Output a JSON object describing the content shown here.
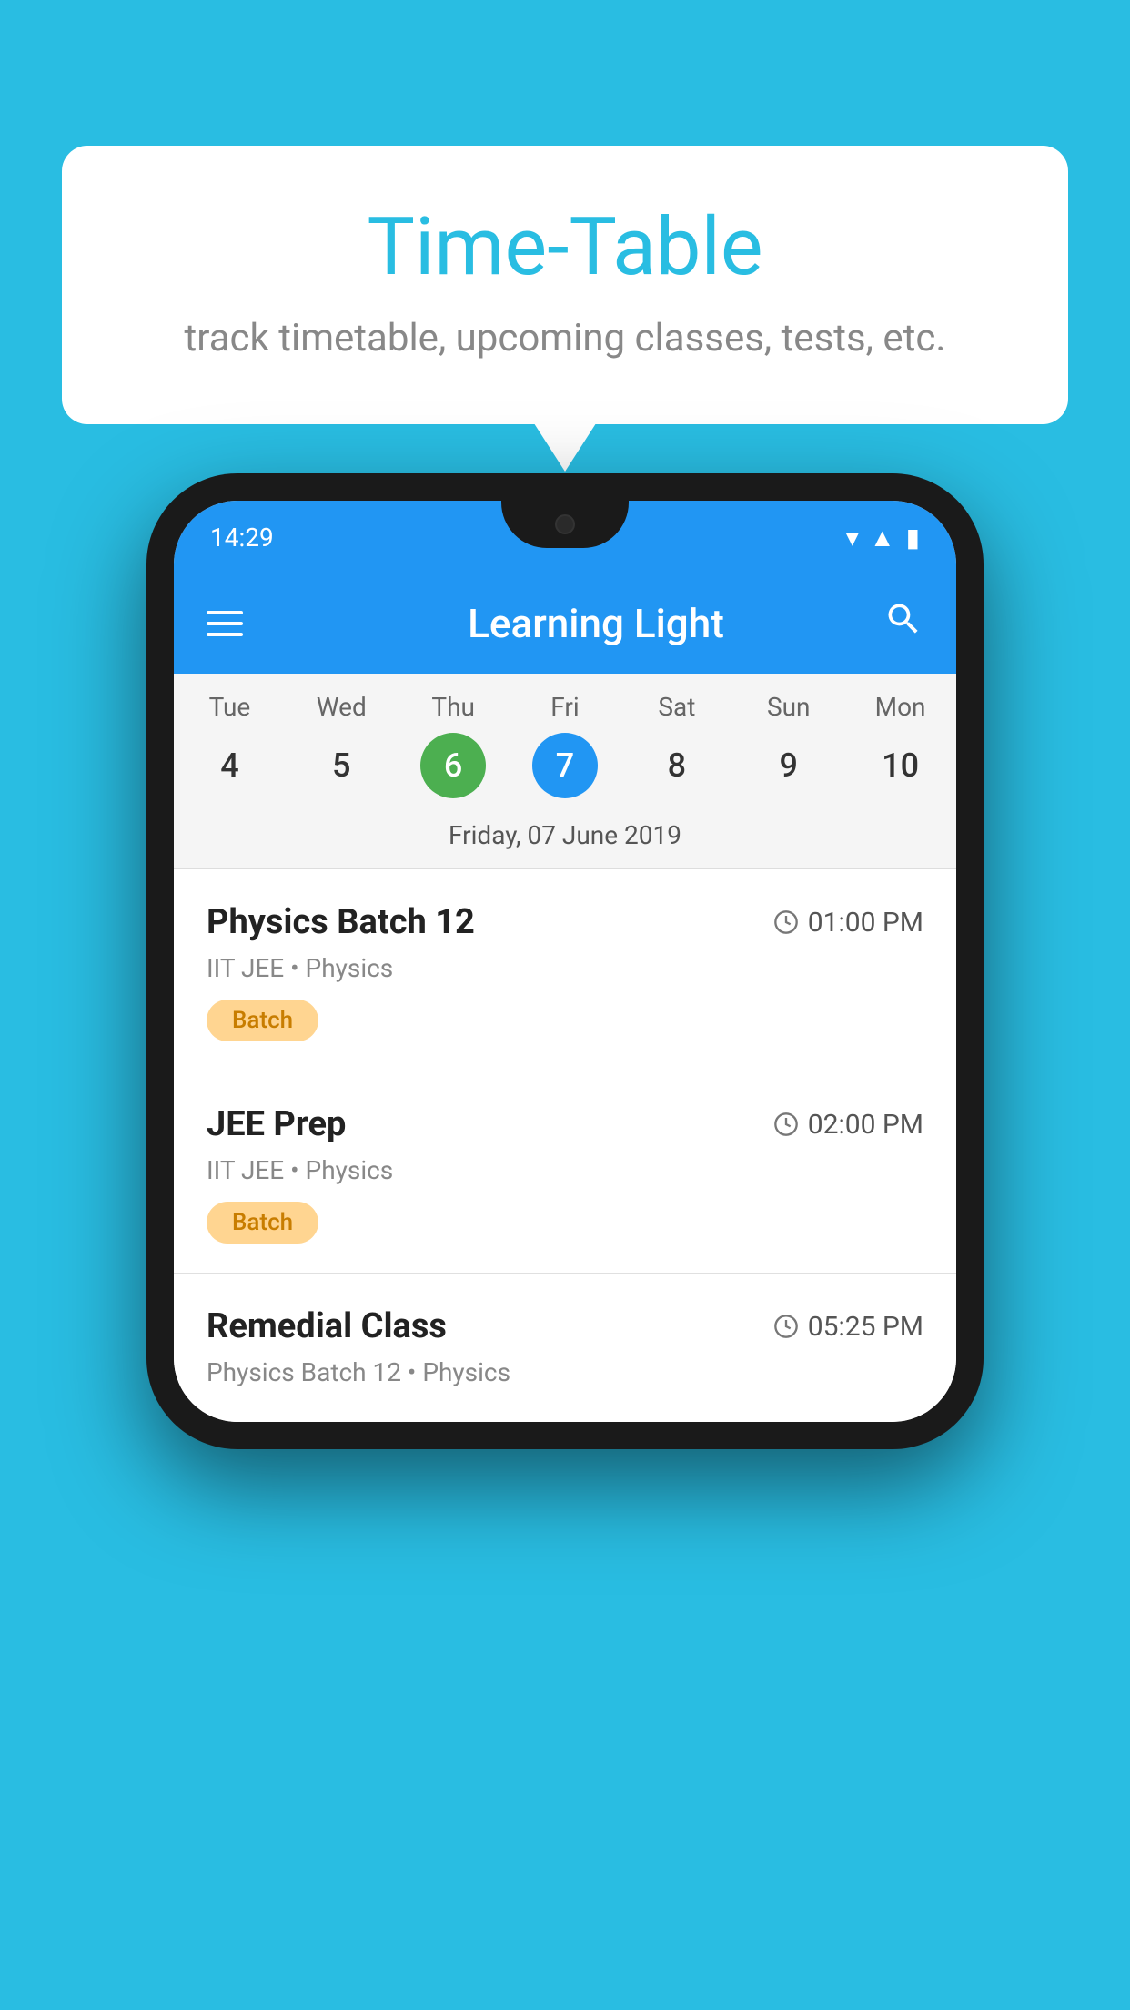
{
  "background": {
    "color": "#29bde2"
  },
  "bubble": {
    "title": "Time-Table",
    "subtitle": "track timetable, upcoming classes, tests, etc."
  },
  "phone": {
    "status": {
      "time": "14:29"
    },
    "appBar": {
      "title": "Learning Light",
      "menu_icon": "≡",
      "search_icon": "🔍"
    },
    "calendar": {
      "days": [
        {
          "name": "Tue",
          "number": "4",
          "state": "normal"
        },
        {
          "name": "Wed",
          "number": "5",
          "state": "normal"
        },
        {
          "name": "Thu",
          "number": "6",
          "state": "today"
        },
        {
          "name": "Fri",
          "number": "7",
          "state": "selected"
        },
        {
          "name": "Sat",
          "number": "8",
          "state": "normal"
        },
        {
          "name": "Sun",
          "number": "9",
          "state": "normal"
        },
        {
          "name": "Mon",
          "number": "10",
          "state": "normal"
        }
      ],
      "selected_date_label": "Friday, 07 June 2019"
    },
    "schedule": [
      {
        "title": "Physics Batch 12",
        "time": "01:00 PM",
        "subtitle": "IIT JEE • Physics",
        "badge": "Batch"
      },
      {
        "title": "JEE Prep",
        "time": "02:00 PM",
        "subtitle": "IIT JEE • Physics",
        "badge": "Batch"
      },
      {
        "title": "Remedial Class",
        "time": "05:25 PM",
        "subtitle": "Physics Batch 12 • Physics",
        "badge": null
      }
    ]
  }
}
